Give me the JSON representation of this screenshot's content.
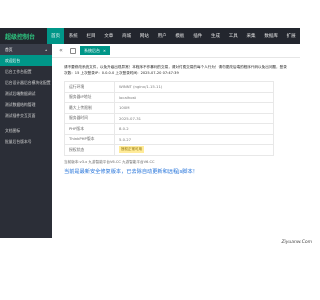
{
  "topbar": {
    "logo": "超级控制台",
    "nav": [
      "首页",
      "系统",
      "栏目",
      "文章",
      "商城",
      "网站",
      "用户",
      "模板",
      "插件",
      "生成",
      "工具",
      "采集",
      "数据库",
      "扩展"
    ]
  },
  "sidebar": {
    "header": "首页",
    "items": [
      "欢迎后台",
      "后台工作台配置",
      "后台设计器后台模块化配置",
      "测试后端数据调试",
      "测试数据结构管理",
      "测试插件交互页面"
    ],
    "section2": [
      "文档图标",
      "批量后台版本号"
    ]
  },
  "tabs": {
    "prev": "«",
    "next": "»",
    "active": "系统后台"
  },
  "notice": "请不要修改系统文件，以免升级出现异常！本程序不作暴利的交易，请对付费交易的每个人行为！请勿更改后端的程序代码以免出问题，登录次数：15 上次登录IP：0.0.0.0 上次登录时间：2025-07-20 07:47:39",
  "info": [
    {
      "k": "运行环境",
      "v": "WINNT (nginx/1.15.11)"
    },
    {
      "k": "服务器IP地址",
      "v": "localhost"
    },
    {
      "k": "最大上传限制",
      "v": "100M"
    },
    {
      "k": "服务器时间",
      "v": "2025-07-31"
    },
    {
      "k": "PHP版本",
      "v": "8.0.2"
    },
    {
      "k": "ThinkPHP版本",
      "v": "5.0.27"
    },
    {
      "k": "授权状态",
      "v": "授权正常可用"
    }
  ],
  "version_line": "当前版本:v3.x 九游智能平台V6.CC  九游智能平台V6.CC",
  "update_msg": "当前是最新安全修复版本，已去除自动更新和远程js脚本！",
  "watermark": "Ziyuanw.Com",
  "colors": {
    "accent": "#009688",
    "topbar": "#23262e",
    "sidebar": "#2b2e37",
    "link": "#1e6fd9"
  }
}
